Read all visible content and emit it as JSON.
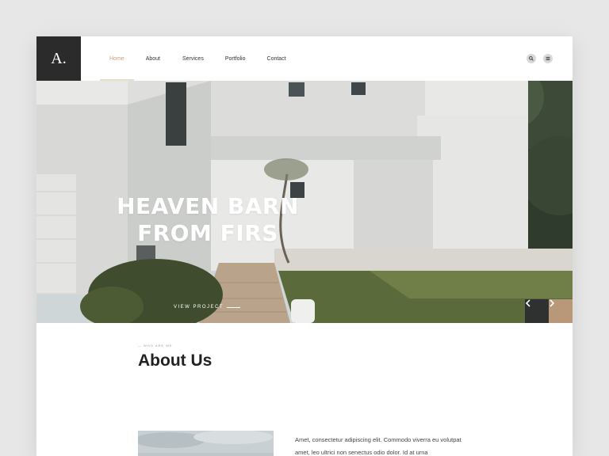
{
  "logo": {
    "text": "A."
  },
  "nav": {
    "items": [
      {
        "label": "Home",
        "active": true
      },
      {
        "label": "About",
        "active": false
      },
      {
        "label": "Services",
        "active": false
      },
      {
        "label": "Portfolio",
        "active": false
      },
      {
        "label": "Contact",
        "active": false
      }
    ]
  },
  "header_icons": [
    "search-icon",
    "menu-icon"
  ],
  "hero": {
    "title_line1": "HEAVEN BARN",
    "title_line2": "FROM FIRS",
    "cta": "VIEW PROJECT",
    "prev_icon": "chevron-left-icon",
    "next_icon": "chevron-right-icon"
  },
  "about": {
    "eyebrow": "— WHO ARE WE",
    "title": "About Us",
    "text": "Amet, consectetur adipiscing elit. Commodo viverra eu volutpat amet, leo ultrici non senectus odio dolor. Id at urna"
  },
  "colors": {
    "accent": "#c8a27a",
    "dark": "#2b2b2b",
    "next_button": "#b9987a"
  }
}
